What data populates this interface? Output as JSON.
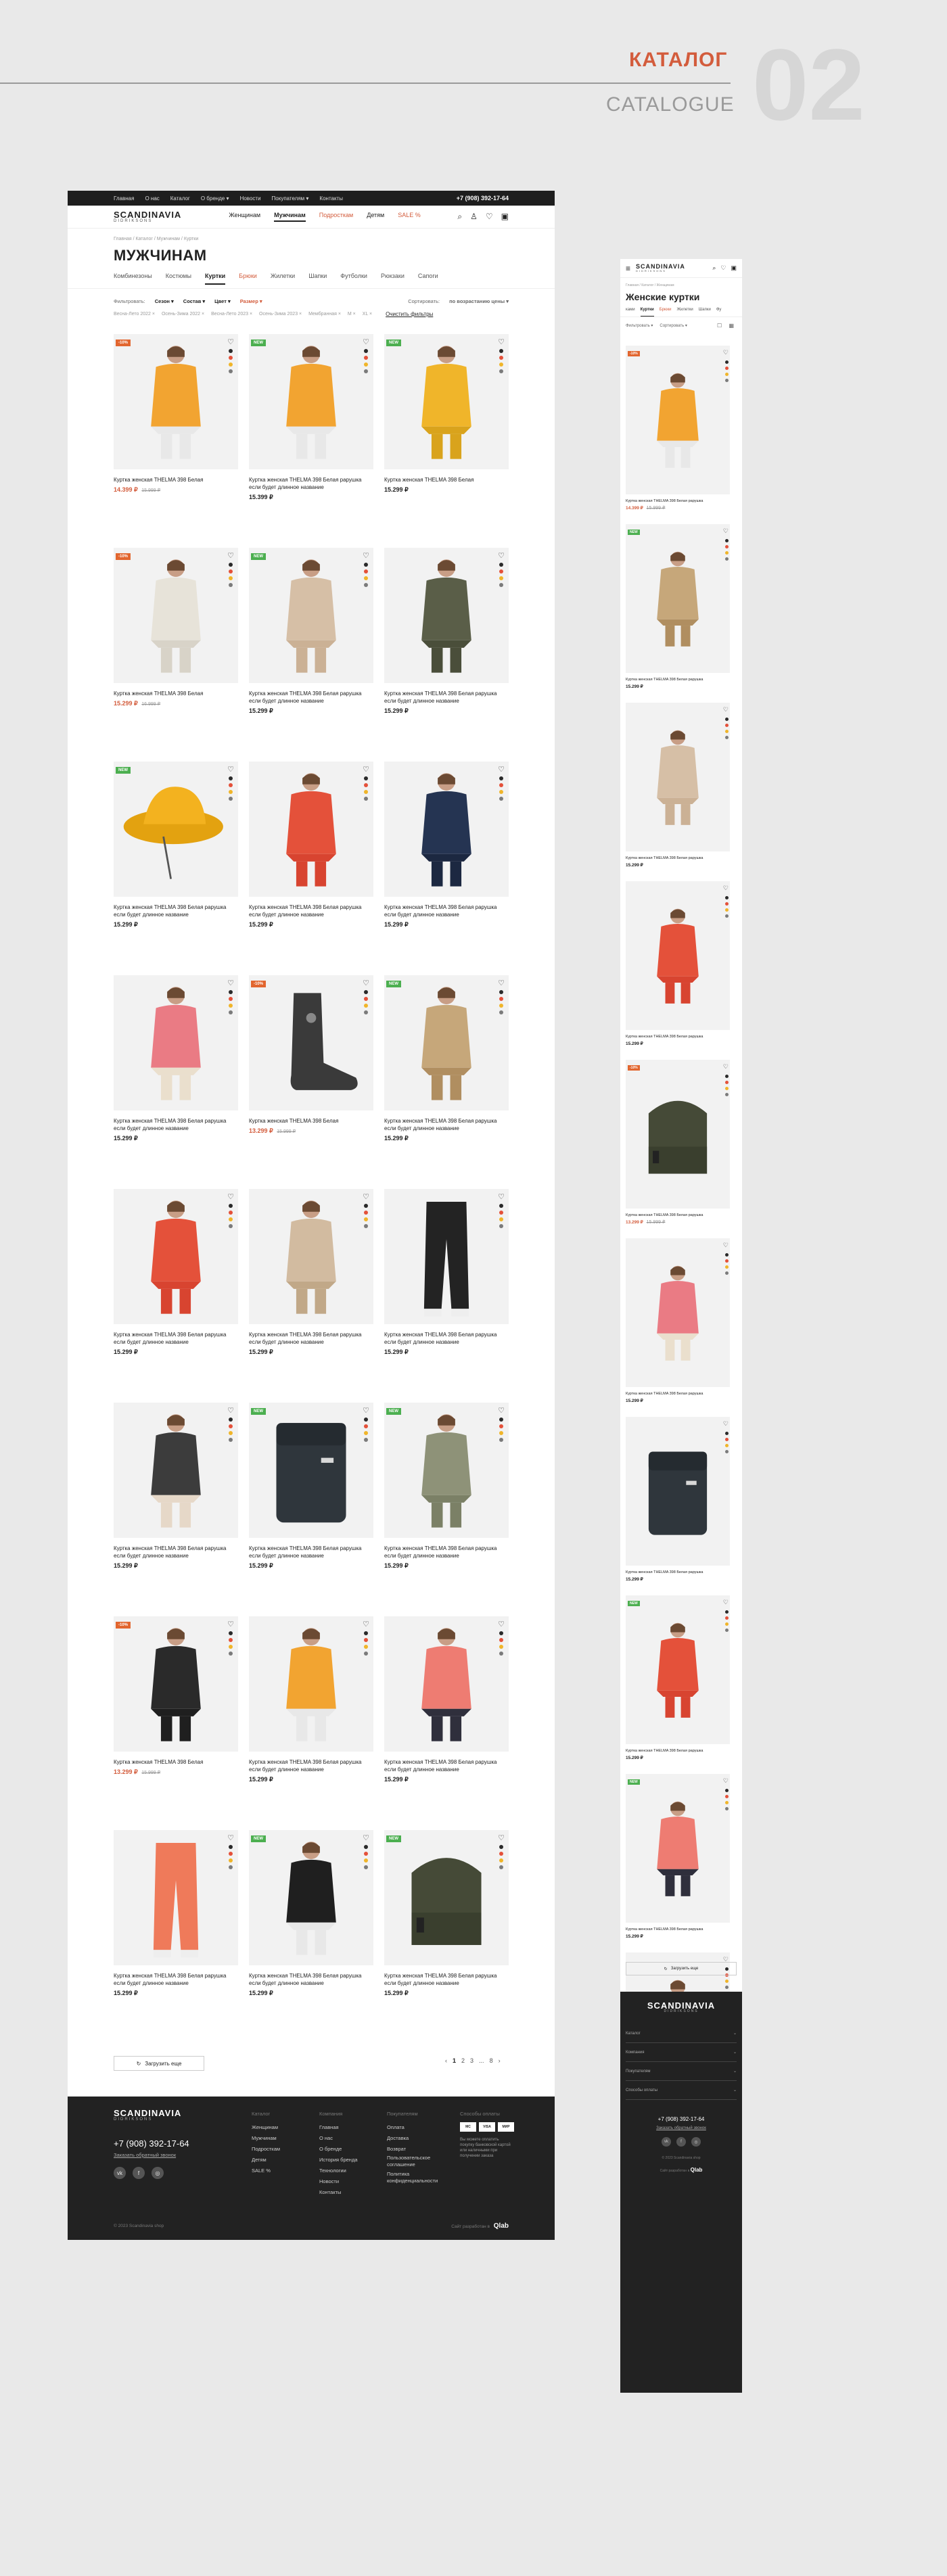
{
  "header": {
    "title": "КАТАЛОГ",
    "subtitle": "CATALOGUE",
    "number": "02"
  },
  "desktop": {
    "topbar": {
      "links": [
        "Главная",
        "О нас",
        "Каталог",
        "О бренде ▾",
        "Новости",
        "Покупателям ▾",
        "Контакты"
      ],
      "phone": "+7 (908) 392-17-64"
    },
    "logo": {
      "brand": "SCANDINAVIA",
      "sub": "DIDRIKSONS"
    },
    "nav": {
      "women": "Женщинам",
      "men": "Мужчинам",
      "teens": "Подросткам",
      "kids": "Детям",
      "sale": "SALE %"
    },
    "breadcrumb": "Главная / Каталог / Мужчинам / Куртки",
    "page_title": "МУЖЧИНАМ",
    "categories": [
      "Комбинезоны",
      "Костюмы",
      "Куртки",
      "Брюки",
      "Жилетки",
      "Шапки",
      "Футболки",
      "Рюкзаки",
      "Сапоги"
    ],
    "filters": {
      "label": "Фильтровать:",
      "items": [
        "Сезон ▾",
        "Состав ▾",
        "Цвет ▾",
        "Размер ▾"
      ],
      "sort_label": "Сортировать:",
      "sort_value": "по возрастанию цены ▾"
    },
    "chips": [
      "Весна-Лето 2022 ×",
      "Осень-Зима 2022 ×",
      "Весна-Лето 2023 ×",
      "Осень-Зима 2023 ×",
      "Мембранная ×",
      "M ×",
      "XL ×"
    ],
    "chips_clear": "Очистить фильтры",
    "load_more": "Загрузить еще",
    "pager": {
      "prev": "‹",
      "pages": [
        "1",
        "2",
        "3",
        "...",
        "8"
      ],
      "next": "›"
    },
    "footer": {
      "phone": "+7 (908) 392-17-64",
      "callback": "Заказать обратный звонок",
      "col1": {
        "title": "Каталог",
        "items": [
          "Женщинам",
          "Мужчинам",
          "Подросткам",
          "Детям",
          "SALE %"
        ]
      },
      "col2": {
        "title": "Компания",
        "items": [
          "Главная",
          "О нас",
          "О бренде",
          "История бренда",
          "Технологии",
          "Новости",
          "Контакты"
        ]
      },
      "col3": {
        "title": "Покупателям",
        "items": [
          "Оплата",
          "Доставка",
          "Возврат",
          "Пользовательское соглашение",
          "Политика конфиденциальности"
        ]
      },
      "col4": {
        "title": "Способы оплаты",
        "note": "Вы можете оплатить покупку банковской картой или наличными при получении заказа"
      },
      "pay": [
        "MC",
        "VISA",
        "МИР"
      ],
      "copyright": "© 2023 Scandinavia shop",
      "dev_label": "Сайт разработан в",
      "dev_name": "Qlab"
    }
  },
  "products": [
    {
      "name": "Куртка женская THELMA 398 Белая",
      "price": "14.399 ₽",
      "old": "15.999 ₽",
      "badge": "-10%",
      "type": "sale",
      "fig": "person",
      "c": "#f2a431",
      "c2": "#e8e8e8"
    },
    {
      "name": "Куртка женская THELMA 398 Белая рарушка если будет длинное название",
      "price": "15.399 ₽",
      "old": "",
      "badge": "NEW",
      "type": "new",
      "fig": "person",
      "c": "#f2a431",
      "c2": "#e8e8e8"
    },
    {
      "name": "Куртка женская THELMA 398 Белая",
      "price": "15.299 ₽",
      "old": "",
      "badge": "NEW",
      "type": "new",
      "fig": "person",
      "c": "#f0b52a",
      "c2": "#d9a31c"
    },
    {
      "name": "Куртка женская THELMA 398 Белая",
      "price": "15.299 ₽",
      "old": "16.999 ₽",
      "badge": "-10%",
      "type": "sale",
      "fig": "person",
      "c": "#e7e3d9",
      "c2": "#d8d3c8"
    },
    {
      "name": "Куртка женская THELMA 398 Белая рарушка если будет длинное название",
      "price": "15.299 ₽",
      "old": "",
      "badge": "NEW",
      "type": "new",
      "fig": "person",
      "c": "#d6bfa6",
      "c2": "#cbb195"
    },
    {
      "name": "Куртка женская THELMA 398 Белая рарушка если будет длинное название",
      "price": "15.299 ₽",
      "old": "",
      "badge": "",
      "type": "",
      "fig": "person",
      "c": "#5a5e48",
      "c2": "#4a4e3a"
    },
    {
      "name": "Куртка женская THELMA 398 Белая рарушка если будет длинное название",
      "price": "15.299 ₽",
      "old": "",
      "badge": "NEW",
      "type": "new",
      "fig": "hat",
      "c": "#f3b21f",
      "c2": "#e3a210"
    },
    {
      "name": "Куртка женская THELMA 398 Белая рарушка если будет длинное название",
      "price": "15.299 ₽",
      "old": "",
      "badge": "",
      "type": "",
      "fig": "person",
      "c": "#e4513a",
      "c2": "#d84430"
    },
    {
      "name": "Куртка женская THELMA 398 Белая рарушка если будет длинное название",
      "price": "15.299 ₽",
      "old": "",
      "badge": "",
      "type": "",
      "fig": "person",
      "c": "#253452",
      "c2": "#1c2841"
    },
    {
      "name": "Куртка женская THELMA 398 Белая рарушка если будет длинное название",
      "price": "15.299 ₽",
      "old": "",
      "badge": "",
      "type": "",
      "fig": "person",
      "c": "#ea7b84",
      "c2": "#eadfcd"
    },
    {
      "name": "Куртка женская THELMA 398 Белая",
      "price": "13.299 ₽",
      "old": "15.999 ₽",
      "badge": "-10%",
      "type": "sale",
      "fig": "boot",
      "c": "#3a3a3a",
      "c2": "#2a2a2a"
    },
    {
      "name": "Куртка женская THELMA 398 Белая рарушка если будет длинное название",
      "price": "15.299 ₽",
      "old": "",
      "badge": "NEW",
      "type": "new",
      "fig": "person",
      "c": "#c6a77a",
      "c2": "#b08e60"
    },
    {
      "name": "Куртка женская THELMA 398 Белая рарушка если будет длинное название",
      "price": "15.299 ₽",
      "old": "",
      "badge": "",
      "type": "",
      "fig": "person",
      "c": "#e4513a",
      "c2": "#d84430"
    },
    {
      "name": "Куртка женская THELMA 398 Белая рарушка если будет длинное название",
      "price": "15.299 ₽",
      "old": "",
      "badge": "",
      "type": "",
      "fig": "person",
      "c": "#d2bba0",
      "c2": "#c1a888"
    },
    {
      "name": "Куртка женская THELMA 398 Белая рарушка если будет длинное название",
      "price": "15.299 ₽",
      "old": "",
      "badge": "",
      "type": "",
      "fig": "pants",
      "c": "#232323",
      "c2": "#1a1a1a"
    },
    {
      "name": "Куртка женская THELMA 398 Белая рарушка если будет длинное название",
      "price": "15.299 ₽",
      "old": "",
      "badge": "",
      "type": "",
      "fig": "person",
      "c": "#3c3c3c",
      "c2": "#e6d8c8"
    },
    {
      "name": "Куртка женская THELMA 398 Белая рарушка если будет длинное название",
      "price": "15.299 ₽",
      "old": "",
      "badge": "NEW",
      "type": "new",
      "fig": "backpack",
      "c": "#2f363c",
      "c2": "#252b30"
    },
    {
      "name": "Куртка женская THELMA 398 Белая рарушка если будет длинное название",
      "price": "15.299 ₽",
      "old": "",
      "badge": "NEW",
      "type": "new",
      "fig": "person",
      "c": "#8e9278",
      "c2": "#7b8066"
    },
    {
      "name": "Куртка женская THELMA 398 Белая",
      "price": "13.299 ₽",
      "old": "15.999 ₽",
      "badge": "-10%",
      "type": "sale",
      "fig": "person",
      "c": "#2a2a2a",
      "c2": "#1f1f1f"
    },
    {
      "name": "Куртка женская THELMA 398 Белая рарушка если будет длинное название",
      "price": "15.299 ₽",
      "old": "",
      "badge": "",
      "type": "",
      "fig": "person",
      "c": "#f2a431",
      "c2": "#e8e8e8"
    },
    {
      "name": "Куртка женская THELMA 398 Белая рарушка если будет длинное название",
      "price": "15.299 ₽",
      "old": "",
      "badge": "",
      "type": "",
      "fig": "person",
      "c": "#ee7c72",
      "c2": "#2f2f3c"
    },
    {
      "name": "Куртка женская THELMA 398 Белая рарушка если будет длинное название",
      "price": "15.299 ₽",
      "old": "",
      "badge": "",
      "type": "",
      "fig": "pants",
      "c": "#ef7a5a",
      "c2": "#e8e8e8"
    },
    {
      "name": "Куртка женская THELMA 398 Белая рарушка если будет длинное название",
      "price": "15.299 ₽",
      "old": "",
      "badge": "NEW",
      "type": "new",
      "fig": "person",
      "c": "#1f1f1f",
      "c2": "#e8e8e8"
    },
    {
      "name": "Куртка женская THELMA 398 Белая рарушка если будет длинное название",
      "price": "15.299 ₽",
      "old": "",
      "badge": "NEW",
      "type": "new",
      "fig": "beanie",
      "c": "#454a37",
      "c2": "#3a3f2e"
    }
  ],
  "mobile": {
    "breadcrumb": "Главная / Каталог / Женщинам",
    "page_title": "Женские куртки",
    "categories": [
      "ками",
      "Куртки",
      "Брюки",
      "Жилетки",
      "Шапки",
      "Фу"
    ],
    "filter": "Фильтровать ▾",
    "sort": "Сортировать ▾",
    "view_icons": "☐ ▦",
    "load_more": "Загрузить еще",
    "items": [
      {
        "name": "Куртка женская THELMA 398 Белая рарушка",
        "price": "14.399 ₽",
        "old": "15.999 ₽",
        "badge": "-10%",
        "type": "sale",
        "fig": "person",
        "c": "#f2a431",
        "c2": "#e8e8e8"
      },
      {
        "name": "Куртка женская THELMA 398 Белая рарушка",
        "price": "15.299 ₽",
        "old": "",
        "badge": "NEW",
        "type": "new",
        "fig": "person",
        "c": "#c6a77a",
        "c2": "#b08e60"
      },
      {
        "name": "Куртка женская THELMA 398 Белая рарушка",
        "price": "15.299 ₽",
        "old": "",
        "badge": "",
        "type": "",
        "fig": "person",
        "c": "#d6bfa6",
        "c2": "#cbb195"
      },
      {
        "name": "Куртка женская THELMA 398 Белая рарушка",
        "price": "15.299 ₽",
        "old": "",
        "badge": "",
        "type": "",
        "fig": "person",
        "c": "#e4513a",
        "c2": "#d84430"
      },
      {
        "name": "Куртка женская THELMA 398 Белая рарушка",
        "price": "13.299 ₽",
        "old": "15.999 ₽",
        "badge": "-10%",
        "type": "sale",
        "fig": "beanie",
        "c": "#454a37",
        "c2": "#3a3f2e"
      },
      {
        "name": "Куртка женская THELMA 398 Белая рарушка",
        "price": "15.299 ₽",
        "old": "",
        "badge": "",
        "type": "",
        "fig": "person",
        "c": "#ea7b84",
        "c2": "#eadfcd"
      },
      {
        "name": "Куртка женская THELMA 398 Белая рарушка",
        "price": "15.299 ₽",
        "old": "",
        "badge": "",
        "type": "",
        "fig": "backpack",
        "c": "#2f363c",
        "c2": "#252b30"
      },
      {
        "name": "Куртка женская THELMA 398 Белая рарушка",
        "price": "15.299 ₽",
        "old": "",
        "badge": "NEW",
        "type": "new",
        "fig": "person",
        "c": "#e4513a",
        "c2": "#d84430"
      },
      {
        "name": "Куртка женская THELMA 398 Белая рарушка",
        "price": "15.299 ₽",
        "old": "",
        "badge": "NEW",
        "type": "new",
        "fig": "person",
        "c": "#ee7c72",
        "c2": "#2f2f3c"
      },
      {
        "name": "Куртка женская THELMA 398 Белая рарушка",
        "price": "15.299 ₽",
        "old": "",
        "badge": "",
        "type": "",
        "fig": "person",
        "c": "#2a2a2a",
        "c2": "#1f1f1f"
      }
    ],
    "footer": {
      "accordion": [
        "Каталог",
        "Компания",
        "Покупателям",
        "Способы оплаты"
      ],
      "phone": "+7 (908) 392-17-64",
      "callback": "Заказать обратный звонок",
      "copyright": "© 2023 Scandinavia shop",
      "dev_label": "Сайт разработан в",
      "dev_name": "Qlab"
    }
  },
  "colors": {
    "accent": "#d35c3c",
    "sale": "#e2662f",
    "new": "#4caf50",
    "dots": [
      "#2a2a2a",
      "#e4513a",
      "#f0b52a",
      "#7b7b7b"
    ]
  }
}
